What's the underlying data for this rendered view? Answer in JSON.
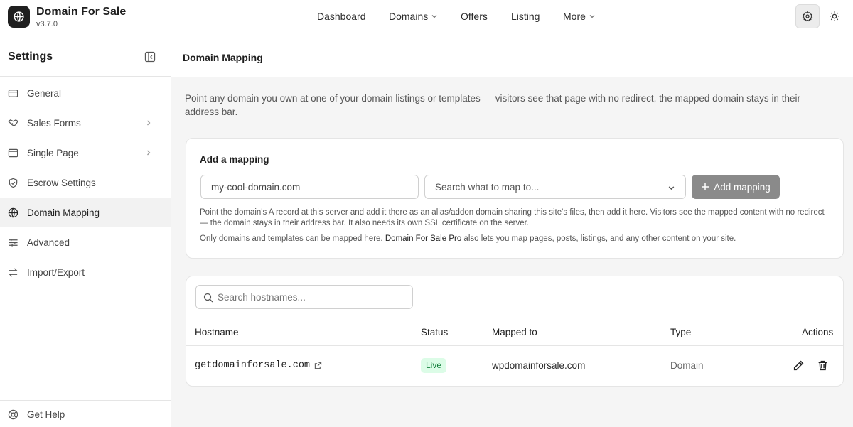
{
  "brand": {
    "title": "Domain For Sale",
    "version": "v3.7.0"
  },
  "nav": {
    "items": [
      {
        "label": "Dashboard"
      },
      {
        "label": "Domains"
      },
      {
        "label": "Offers"
      },
      {
        "label": "Listing"
      },
      {
        "label": "More"
      }
    ]
  },
  "sidebar": {
    "title": "Settings",
    "items": [
      {
        "label": "General",
        "icon": "id-card-icon"
      },
      {
        "label": "Sales Forms",
        "icon": "handshake-icon"
      },
      {
        "label": "Single Page",
        "icon": "browser-icon"
      },
      {
        "label": "Escrow Settings",
        "icon": "shield-check-icon"
      },
      {
        "label": "Domain Mapping",
        "icon": "globe-icon"
      },
      {
        "label": "Advanced",
        "icon": "sliders-icon"
      },
      {
        "label": "Import/Export",
        "icon": "arrows-swap-icon"
      }
    ],
    "footer": {
      "label": "Get Help",
      "icon": "help-circle-icon"
    }
  },
  "main": {
    "title": "Domain Mapping",
    "intro": "Point any domain you own at one of your domain listings or templates — visitors see that page with no redirect, the mapped domain stays in their address bar.",
    "add_card": {
      "title": "Add a mapping",
      "domain_input_value": "my-cool-domain.com",
      "select_placeholder": "Search what to map to...",
      "add_button": "Add mapping",
      "help_text": "Point the domain's A record at this server and add it there as an alias/addon domain sharing this site's files, then add it here. Visitors see the mapped content with no redirect — the domain stays in their address bar. It also needs its own SSL certificate on the server.",
      "pro_note_prefix": "Only domains and templates can be mapped here.",
      "pro_link": "Domain For Sale Pro",
      "pro_note_suffix": "also lets you map pages, posts, listings, and any other content on your site."
    },
    "table": {
      "search_placeholder": "Search hostnames...",
      "columns": {
        "hostname": "Hostname",
        "status": "Status",
        "mapped_to": "Mapped to",
        "type": "Type",
        "actions": "Actions"
      },
      "rows": [
        {
          "hostname": "getdomainforsale.com",
          "status": "Live",
          "mapped_to": "wpdomainforsale.com",
          "type": "Domain"
        }
      ]
    }
  },
  "colors": {
    "accent": "#1f1f1f",
    "live_bg": "#dcfce7",
    "live_text": "#15803d",
    "button_disabled": "#8a8a8a"
  }
}
